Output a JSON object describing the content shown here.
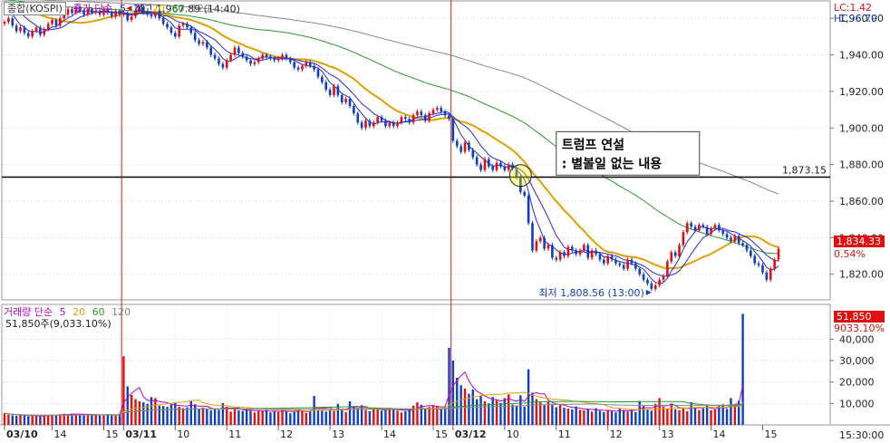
{
  "price_legend": {
    "symbol": "종합(KOSPI)",
    "title": "종가 단순",
    "ma": [
      {
        "period": "5",
        "color": "#2a2ad0"
      },
      {
        "period": "10",
        "color": "#2a2ad0"
      },
      {
        "period": "20",
        "color": "#e0a000"
      },
      {
        "period": "60",
        "color": "#2a9a2a"
      },
      {
        "period": "120",
        "color": "#888888"
      }
    ],
    "colors": {
      "title": "#c000c0",
      "symbol": "#333333"
    }
  },
  "volume_legend": {
    "title": "거래량 단순",
    "ma": [
      {
        "period": "5",
        "color": "#c000c0"
      },
      {
        "period": "20",
        "color": "#e0a000"
      },
      {
        "period": "60",
        "color": "#2a9a2a"
      },
      {
        "period": "120",
        "color": "#888888"
      }
    ],
    "value_text": "51,850주(9,033.10%)"
  },
  "indicators": {
    "lc": "LC:1.42",
    "hc": "HC:-6.79"
  },
  "annotations": {
    "high_label": "최고 1,967.89 (14:40)",
    "low_label": "최저 1,808.56 (13:00)",
    "horizontal_line_value": "1,873.15",
    "callout_line1": "트럼프 연설",
    "callout_line2": ": 별볼일 없는 내용"
  },
  "current": {
    "price": "1,834.33",
    "change": "0.54%",
    "volume": "51,850",
    "volume_pct": "9033.10%"
  },
  "time_label": "15:30:00",
  "colors": {
    "up": "#e01010",
    "down": "#1040c0",
    "ma5": "#2a2ad0",
    "ma20": "#e0a000",
    "ma60": "#2a9a2a",
    "ma120": "#888888",
    "vma5": "#c000c0",
    "hline": "#000000",
    "divider": "#cc2020"
  },
  "chart_data": {
    "type": "candlestick",
    "price_axis": {
      "ticks": [
        "1,960.00",
        "1,940.00",
        "1,920.00",
        "1,900.00",
        "1,880.00",
        "1,860.00",
        "1,840.00",
        "1,820.00"
      ],
      "tick_values": [
        1960,
        1940,
        1920,
        1900,
        1880,
        1860,
        1840,
        1820
      ],
      "range": [
        1806,
        1970
      ]
    },
    "volume_axis": {
      "ticks": [
        "40,000",
        "30,000",
        "20,000",
        "10,000"
      ],
      "tick_values": [
        40000,
        30000,
        20000,
        10000
      ],
      "range": [
        0,
        52000
      ]
    },
    "x_ticks": [
      {
        "label": "03/10",
        "bold": true,
        "n": 0
      },
      {
        "label": "14",
        "bold": false,
        "n": 12
      },
      {
        "label": "15",
        "bold": false,
        "n": 25
      },
      {
        "label": "03/11",
        "bold": true,
        "n": 30
      },
      {
        "label": "10",
        "bold": false,
        "n": 43
      },
      {
        "label": "11",
        "bold": false,
        "n": 56
      },
      {
        "label": "12",
        "bold": false,
        "n": 69
      },
      {
        "label": "13",
        "bold": false,
        "n": 82
      },
      {
        "label": "14",
        "bold": false,
        "n": 95
      },
      {
        "label": "15",
        "bold": false,
        "n": 108
      },
      {
        "label": "03/12",
        "bold": true,
        "n": 113
      },
      {
        "label": "10",
        "bold": false,
        "n": 126
      },
      {
        "label": "11",
        "bold": false,
        "n": 139
      },
      {
        "label": "12",
        "bold": false,
        "n": 152
      },
      {
        "label": "13",
        "bold": false,
        "n": 165
      },
      {
        "label": "14",
        "bold": false,
        "n": 178
      },
      {
        "label": "15",
        "bold": false,
        "n": 191
      }
    ],
    "session_starts": [
      30,
      113
    ],
    "high": {
      "value": 1967.89,
      "n": 38
    },
    "low": {
      "value": 1808.56,
      "n": 163
    },
    "hline": 1873.15,
    "close": [
      1958,
      1960,
      1956,
      1953,
      1955,
      1952,
      1950,
      1953,
      1955,
      1951,
      1954,
      1957,
      1959,
      1956,
      1960,
      1962,
      1965,
      1963,
      1966,
      1964,
      1962,
      1965,
      1963,
      1964,
      1962,
      1965,
      1963,
      1961,
      1964,
      1962,
      1963,
      1959,
      1961,
      1964,
      1966,
      1963,
      1962,
      1961,
      1963,
      1960,
      1957,
      1955,
      1952,
      1950,
      1956,
      1957,
      1955,
      1952,
      1948,
      1946,
      1947,
      1944,
      1940,
      1938,
      1935,
      1933,
      1937,
      1940,
      1944,
      1941,
      1939,
      1937,
      1935,
      1936,
      1938,
      1940,
      1939,
      1938,
      1937,
      1938,
      1940,
      1938,
      1936,
      1933,
      1932,
      1934,
      1936,
      1934,
      1932,
      1928,
      1925,
      1921,
      1918,
      1923,
      1918,
      1914,
      1916,
      1912,
      1908,
      1903,
      1900,
      1904,
      1901,
      1903,
      1906,
      1904,
      1901,
      1903,
      1901,
      1903,
      1906,
      1905,
      1903,
      1907,
      1909,
      1907,
      1904,
      1908,
      1910,
      1911,
      1909,
      1907,
      1905,
      1893,
      1890,
      1887,
      1892,
      1888,
      1884,
      1880,
      1877,
      1883,
      1879,
      1877,
      1881,
      1879,
      1877,
      1880,
      1878,
      1873,
      1865,
      1863,
      1848,
      1833,
      1838,
      1840,
      1834,
      1836,
      1829,
      1828,
      1832,
      1830,
      1835,
      1833,
      1831,
      1833,
      1836,
      1829,
      1833,
      1831,
      1828,
      1826,
      1830,
      1828,
      1826,
      1825,
      1823,
      1828,
      1826,
      1823,
      1820,
      1817,
      1815,
      1812,
      1814,
      1817,
      1819,
      1827,
      1832,
      1830,
      1836,
      1843,
      1848,
      1846,
      1844,
      1847,
      1846,
      1842,
      1845,
      1847,
      1844,
      1842,
      1840,
      1838,
      1841,
      1837,
      1836,
      1833,
      1830,
      1826,
      1825,
      1821,
      1817,
      1823,
      1828,
      1834
    ],
    "volume": [
      5500,
      4800,
      4500,
      4200,
      4600,
      4400,
      4000,
      4300,
      4500,
      4200,
      4100,
      4600,
      4800,
      4400,
      5000,
      5200,
      4900,
      5300,
      4700,
      5100,
      4800,
      4600,
      5000,
      4700,
      4400,
      4800,
      5000,
      4600,
      4400,
      5200,
      32000,
      18000,
      14000,
      12000,
      11000,
      10500,
      9800,
      13000,
      12500,
      9000,
      8800,
      8400,
      9500,
      10200,
      8500,
      7800,
      8200,
      11000,
      9600,
      7200,
      8000,
      7600,
      6800,
      7400,
      7000,
      10200,
      8400,
      6200,
      7500,
      6800,
      6500,
      7200,
      6600,
      5800,
      6900,
      6400,
      7000,
      5800,
      6200,
      6000,
      7200,
      6600,
      5400,
      6000,
      7400,
      6800,
      5600,
      6200,
      13500,
      7000,
      6600,
      6200,
      7400,
      6400,
      9800,
      6800,
      6000,
      11000,
      8200,
      7600,
      9200,
      7000,
      6400,
      7800,
      7200,
      6600,
      6800,
      8000,
      7600,
      6600,
      5800,
      6400,
      7200,
      9000,
      10500,
      9400,
      7600,
      8400,
      9200,
      8800,
      7800,
      8200,
      36000,
      30000,
      22000,
      18500,
      17000,
      14500,
      16500,
      12000,
      13500,
      11000,
      10000,
      13000,
      11500,
      10200,
      12500,
      14200,
      9500,
      9000,
      13800,
      8500,
      26000,
      15000,
      12000,
      10500,
      9200,
      11000,
      9800,
      8200,
      9400,
      8000,
      7600,
      7200,
      8600,
      7000,
      6800,
      7400,
      6200,
      7800,
      6600,
      6000,
      7000,
      6400,
      5800,
      7600,
      6800,
      6200,
      7400,
      6000,
      11200,
      8800,
      7000,
      6600,
      9800,
      12500,
      8400,
      7600,
      10000,
      7200,
      6800,
      7800,
      6400,
      10600,
      8200,
      7000,
      7600,
      9000,
      6800,
      7200,
      8800,
      9600,
      7400,
      12500,
      9200,
      11200,
      51850
    ]
  }
}
